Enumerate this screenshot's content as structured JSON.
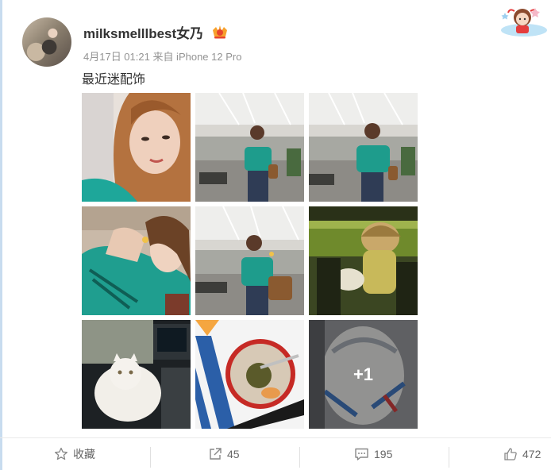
{
  "post": {
    "username": "milksmelllbest女乃",
    "meta": "4月17日 01:21 来自 iPhone 12 Pro",
    "text": "最近迷配饰",
    "images": [
      {
        "desc": "selfie-closeup"
      },
      {
        "desc": "mirror-selfie-office"
      },
      {
        "desc": "mirror-selfie-office"
      },
      {
        "desc": "selfie-lying-green-shirt"
      },
      {
        "desc": "mirror-selfie-office"
      },
      {
        "desc": "car-interior-with-cat"
      },
      {
        "desc": "white-cat-in-car"
      },
      {
        "desc": "dessert-bowl"
      },
      {
        "desc": "plush-bag"
      }
    ],
    "more_count": "+1"
  },
  "actions": {
    "favorite_label": "收藏",
    "repost_count": "45",
    "comment_count": "195",
    "like_count": "472"
  },
  "colors": {
    "username": "#333333",
    "meta": "#939393",
    "action_text": "#666666"
  }
}
